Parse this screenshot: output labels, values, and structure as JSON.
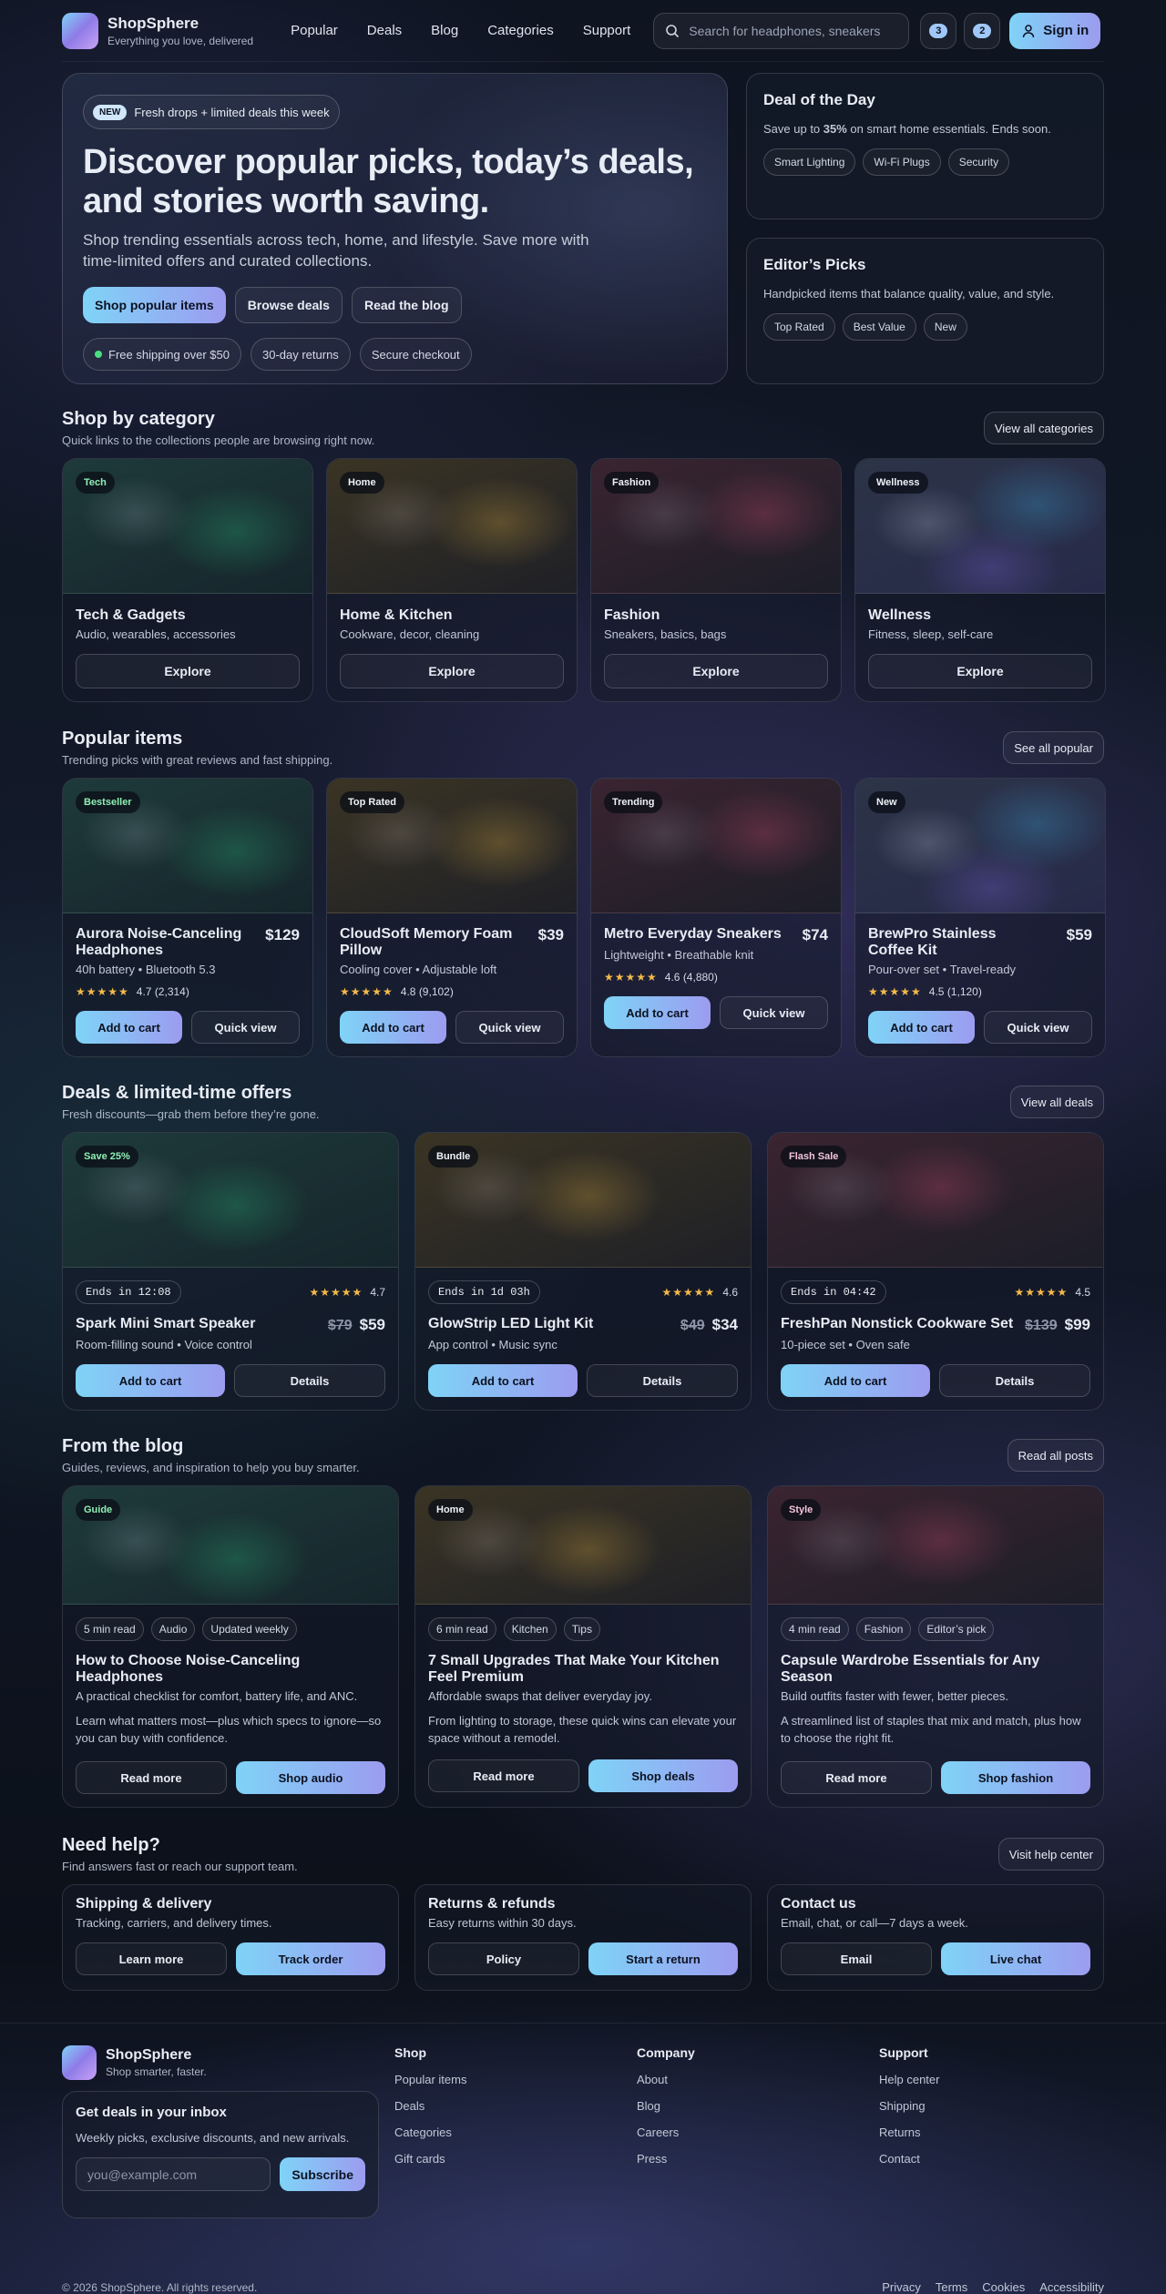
{
  "header": {
    "brand": "ShopSphere",
    "tagline": "Everything you love, delivered",
    "nav": [
      "Popular",
      "Deals",
      "Blog",
      "Categories",
      "Support"
    ],
    "search_placeholder": "Search for headphones, sneakers",
    "wishlist_count": "3",
    "cart_count": "2",
    "signin": "Sign in"
  },
  "hero": {
    "badge": "NEW",
    "badge_text": "Fresh drops + limited deals this week",
    "title": "Discover popular picks, today’s deals, and stories worth saving.",
    "subtitle": "Shop trending essentials across tech, home, and lifestyle. Save more with time-limited offers and curated collections.",
    "btn_primary": "Shop popular items",
    "btn_deals": "Browse deals",
    "btn_blog": "Read the blog",
    "chips": [
      "Free shipping over $50",
      "30-day returns",
      "Secure checkout"
    ]
  },
  "deal_of_day": {
    "title": "Deal of the Day",
    "text_pre": "Save up to ",
    "text_bold": "35%",
    "text_post": " on smart home essentials. Ends soon.",
    "chips": [
      "Smart Lighting",
      "Wi-Fi Plugs",
      "Security"
    ]
  },
  "editors": {
    "title": "Editor’s Picks",
    "text": "Handpicked items that balance quality, value, and style.",
    "chips": [
      "Top Rated",
      "Best Value",
      "New"
    ]
  },
  "categories": {
    "title": "Shop by category",
    "subtitle": "Quick links to the collections people are browsing right now.",
    "view_all": "View all categories",
    "items": [
      {
        "tag": "Tech",
        "title": "Tech & Gadgets",
        "sub": "Audio, wearables, accessories",
        "btn": "Explore"
      },
      {
        "tag": "Home",
        "title": "Home & Kitchen",
        "sub": "Cookware, decor, cleaning",
        "btn": "Explore"
      },
      {
        "tag": "Fashion",
        "title": "Fashion",
        "sub": "Sneakers, basics, bags",
        "btn": "Explore"
      },
      {
        "tag": "Wellness",
        "title": "Wellness",
        "sub": "Fitness, sleep, self-care",
        "btn": "Explore"
      }
    ]
  },
  "popular": {
    "title": "Popular items",
    "subtitle": "Trending picks with great reviews and fast shipping.",
    "see_all": "See all popular",
    "items": [
      {
        "tag": "Bestseller",
        "title": "Aurora Noise-Canceling Headphones",
        "price": "$129",
        "sub": "40h battery • Bluetooth 5.3",
        "rating": "4.7 (2,314)",
        "rating_value": 4.7,
        "add": "Add to cart",
        "quick": "Quick view"
      },
      {
        "tag": "Top Rated",
        "title": "CloudSoft Memory Foam Pillow",
        "price": "$39",
        "sub": "Cooling cover • Adjustable loft",
        "rating": "4.8 (9,102)",
        "rating_value": 4.8,
        "add": "Add to cart",
        "quick": "Quick view"
      },
      {
        "tag": "Trending",
        "title": "Metro Everyday Sneakers",
        "price": "$74",
        "sub": "Lightweight • Breathable knit",
        "rating": "4.6 (4,880)",
        "rating_value": 4.6,
        "add": "Add to cart",
        "quick": "Quick view"
      },
      {
        "tag": "New",
        "title": "BrewPro Stainless Coffee Kit",
        "price": "$59",
        "sub": "Pour-over set • Travel-ready",
        "rating": "4.5 (1,120)",
        "rating_value": 4.5,
        "add": "Add to cart",
        "quick": "Quick view"
      }
    ]
  },
  "deals": {
    "title": "Deals & limited-time offers",
    "subtitle": "Fresh discounts—grab them before they’re gone.",
    "view_all": "View all deals",
    "items": [
      {
        "tag": "Save 25%",
        "timer": "Ends in 12:08",
        "rating": "4.7",
        "rating_value": 4.7,
        "title": "Spark Mini Smart Speaker",
        "old": "$79",
        "price": "$59",
        "sub": "Room-filling sound • Voice control",
        "add": "Add to cart",
        "details": "Details"
      },
      {
        "tag": "Bundle",
        "timer": "Ends in 1d 03h",
        "rating": "4.6",
        "rating_value": 4.6,
        "title": "GlowStrip LED Light Kit",
        "old": "$49",
        "price": "$34",
        "sub": "App control • Music sync",
        "add": "Add to cart",
        "details": "Details"
      },
      {
        "tag": "Flash Sale",
        "timer": "Ends in 04:42",
        "rating": "4.5",
        "rating_value": 4.5,
        "title": "FreshPan Nonstick Cookware Set",
        "old": "$139",
        "price": "$99",
        "sub": "10-piece set • Oven safe",
        "add": "Add to cart",
        "details": "Details"
      }
    ]
  },
  "blog": {
    "title": "From the blog",
    "subtitle": "Guides, reviews, and inspiration to help you buy smarter.",
    "read_all": "Read all posts",
    "items": [
      {
        "tag": "Guide",
        "chips": [
          "5 min read",
          "Audio",
          "Updated weekly"
        ],
        "title": "How to Choose Noise-Canceling Headphones",
        "sub": "A practical checklist for comfort, battery life, and ANC.",
        "desc": "Learn what matters most—plus which specs to ignore—so you can buy with confidence.",
        "read": "Read more",
        "shop": "Shop audio"
      },
      {
        "tag": "Home",
        "chips": [
          "6 min read",
          "Kitchen",
          "Tips"
        ],
        "title": "7 Small Upgrades That Make Your Kitchen Feel Premium",
        "sub": "Affordable swaps that deliver everyday joy.",
        "desc": "From lighting to storage, these quick wins can elevate your space without a remodel.",
        "read": "Read more",
        "shop": "Shop deals"
      },
      {
        "tag": "Style",
        "chips": [
          "4 min read",
          "Fashion",
          "Editor’s pick"
        ],
        "title": "Capsule Wardrobe Essentials for Any Season",
        "sub": "Build outfits faster with fewer, better pieces.",
        "desc": "A streamlined list of staples that mix and match, plus how to choose the right fit.",
        "read": "Read more",
        "shop": "Shop fashion"
      }
    ]
  },
  "help": {
    "title": "Need help?",
    "subtitle": "Find answers fast or reach our support team.",
    "visit": "Visit help center",
    "items": [
      {
        "title": "Shipping & delivery",
        "sub": "Tracking, carriers, and delivery times.",
        "b1": "Learn more",
        "b2": "Track order"
      },
      {
        "title": "Returns & refunds",
        "sub": "Easy returns within 30 days.",
        "b1": "Policy",
        "b2": "Start a return"
      },
      {
        "title": "Contact us",
        "sub": "Email, chat, or call—7 days a week.",
        "b1": "Email",
        "b2": "Live chat"
      }
    ]
  },
  "footer": {
    "brand": "ShopSphere",
    "tagline": "Shop smarter, faster.",
    "newsletter_title": "Get deals in your inbox",
    "newsletter_text": "Weekly picks, exclusive discounts, and new arrivals.",
    "email_placeholder": "you@example.com",
    "subscribe": "Subscribe",
    "cols": [
      {
        "title": "Shop",
        "links": [
          "Popular items",
          "Deals",
          "Categories",
          "Gift cards"
        ]
      },
      {
        "title": "Company",
        "links": [
          "About",
          "Blog",
          "Careers",
          "Press"
        ]
      },
      {
        "title": "Support",
        "links": [
          "Help center",
          "Shipping",
          "Returns",
          "Contact"
        ]
      }
    ],
    "copyright": "© 2026 ShopSphere. All rights reserved.",
    "legal": [
      "Privacy",
      "Terms",
      "Cookies",
      "Accessibility"
    ]
  }
}
